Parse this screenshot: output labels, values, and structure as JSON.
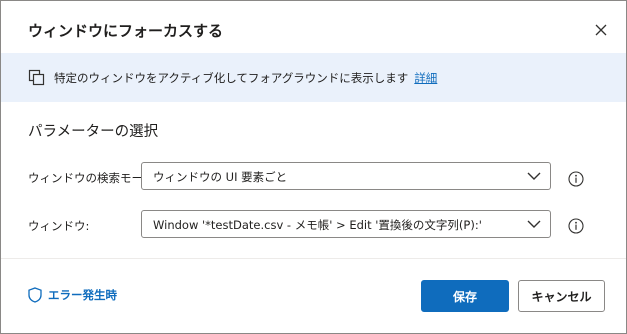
{
  "dialog": {
    "title": "ウィンドウにフォーカスする",
    "close_icon": "close-icon"
  },
  "info": {
    "icon": "window-copy-icon",
    "text": "特定のウィンドウをアクティブ化してフォアグラウンドに表示します",
    "link_label": "詳細"
  },
  "parameters": {
    "section_title": "パラメーターの選択",
    "search_mode": {
      "label": "ウィンドウの検索モード:",
      "value": "ウィンドウの UI 要素ごと"
    },
    "window": {
      "label": "ウィンドウ:",
      "value": "Window '*testDate.csv - メモ帳' > Edit '置換後の文字列(P):'"
    }
  },
  "footer": {
    "error_label": "エラー発生時",
    "save_label": "保存",
    "cancel_label": "キャンセル"
  },
  "colors": {
    "accent": "#0f6cbd",
    "info_band": "#eaf1fb"
  }
}
